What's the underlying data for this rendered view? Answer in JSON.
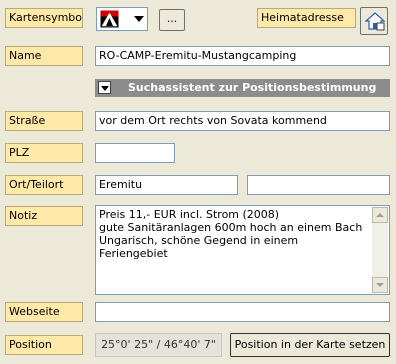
{
  "labels": {
    "kartensymbol": "Kartensymbol",
    "heimatadresse": "Heimatadresse",
    "name": "Name",
    "strasse": "Straße",
    "plz": "PLZ",
    "ort": "Ort/Teilort",
    "notiz": "Notiz",
    "webseite": "Webseite",
    "position": "Position"
  },
  "kartensymbol": {
    "icon": "campsite-tent-icon",
    "browse_label": "..."
  },
  "home_button_icon": "home-icon",
  "values": {
    "name": "RO-CAMP-Eremitu-Mustangcamping",
    "strasse": "vor dem Ort rechts von Sovata kommend",
    "plz": "",
    "ort": "Eremitu",
    "teilort": "",
    "notiz": [
      "Preis 11,- EUR incl. Strom (2008)",
      "gute Sanitäranlagen 600m hoch an einem Bach",
      "Ungarisch, schöne Gegend in einem Feriengebiet"
    ],
    "webseite": "",
    "position": "25°0' 25\" / 46°40' 7\""
  },
  "wizard_label": "Suchassistent zur Positionsbestimmung",
  "position_button_label": "Position in der Karte setzen",
  "colors": {
    "label_bg": "#ffe9a8",
    "wizard_bg": "#8c8c8c",
    "window_bg": "#ece9d8"
  }
}
